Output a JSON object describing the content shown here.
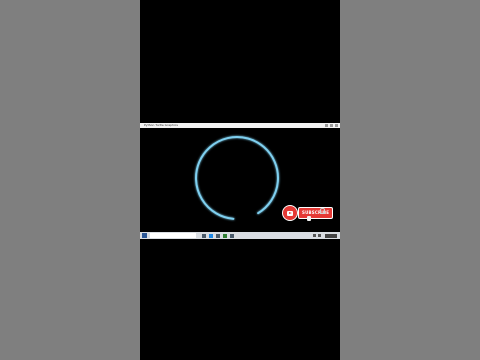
{
  "window": {
    "title": "Python Turtle Graphics"
  },
  "subscribe": {
    "label": "SUBSCRIBE"
  },
  "colors": {
    "stroke": "#7fd0f0",
    "subscribe": "#e53935",
    "background": "#000000",
    "pillarbox": "#7f7f7f"
  },
  "drawing": {
    "shape": "partial-circle",
    "progress": 0.9
  },
  "icons": {
    "subscribe_logo": "play-icon",
    "cursor": "hand-icon",
    "notification": "bell-icon"
  }
}
